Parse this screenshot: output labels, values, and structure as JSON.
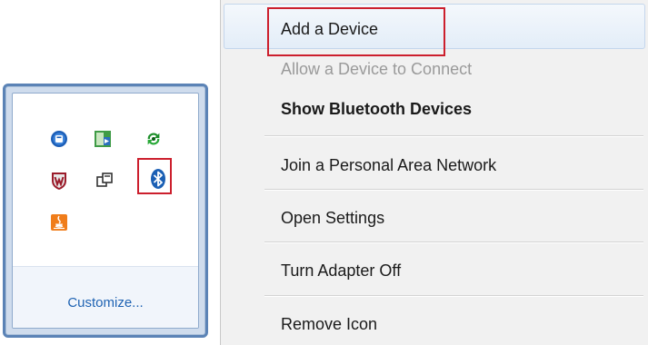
{
  "tray": {
    "icons": [
      {
        "name": "network-icon"
      },
      {
        "name": "display-icon"
      },
      {
        "name": "sync-icon"
      },
      {
        "name": "mcafee-shield-icon"
      },
      {
        "name": "windows-icon"
      },
      {
        "name": "bluetooth-icon"
      },
      {
        "name": "java-icon"
      }
    ],
    "customize_label": "Customize..."
  },
  "menu": {
    "items": [
      {
        "label": "Add a Device",
        "state": "highlighted"
      },
      {
        "label": "Allow a Device to Connect",
        "state": "disabled"
      },
      {
        "label": "Show Bluetooth Devices",
        "state": "default"
      },
      {
        "label": "Join a Personal Area Network",
        "state": "normal"
      },
      {
        "label": "Open Settings",
        "state": "normal"
      },
      {
        "label": "Turn Adapter Off",
        "state": "normal"
      },
      {
        "label": "Remove Icon",
        "state": "normal"
      }
    ]
  },
  "colors": {
    "highlight_box": "#cc1f2d",
    "link": "#1f63b3",
    "tray_border": "#5b83b6",
    "menu_background": "#f1f1f1"
  }
}
